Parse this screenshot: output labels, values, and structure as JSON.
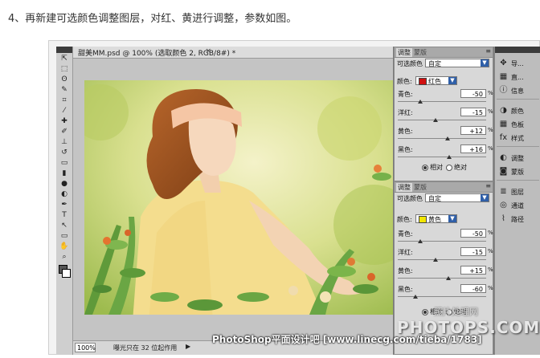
{
  "caption": "4、再新建可选颜色调整图层，对红、黄进行调整，参数如图。",
  "document": {
    "tab_title": "甜美MM.psd @ 100% (选取颜色 2, RGB/8#) *",
    "close_symbol": "×",
    "zoom": "100%",
    "status_info": "曝光只在 32 位起作用",
    "status_arrow": "▶"
  },
  "toolbar": {
    "tools": [
      "move-tool",
      "marquee-tool",
      "lasso-tool",
      "quick-select-tool",
      "crop-tool",
      "eyedropper-tool",
      "healing-tool",
      "brush-tool",
      "stamp-tool",
      "history-brush-tool",
      "eraser-tool",
      "gradient-tool",
      "blur-tool",
      "dodge-tool",
      "pen-tool",
      "type-tool",
      "path-select-tool",
      "shape-tool",
      "hand-tool",
      "zoom-tool"
    ],
    "glyphs": [
      "⇱",
      "⬚",
      "ʘ",
      "✎",
      "⌗",
      "⁄",
      "✚",
      "✐",
      "⊥",
      "↺",
      "▭",
      "▮",
      "●",
      "◐",
      "✒",
      "T",
      "↖",
      "▭",
      "✋",
      "⌕"
    ],
    "fg_color": "#555555",
    "bg_color": "#ffffff"
  },
  "panel_top": {
    "tab_adjust": "调整",
    "tab_mask": "蒙版",
    "menu_symbol": "≡",
    "title": "可选颜色",
    "preset": "自定",
    "colors_label": "颜色:",
    "color_value": "红色",
    "color_chip": "#d01010",
    "sliders": [
      {
        "label": "青色:",
        "value": "-50",
        "pct": "%",
        "level": -50
      },
      {
        "label": "洋红:",
        "value": "-15",
        "pct": "%",
        "level": -15
      },
      {
        "label": "黄色:",
        "value": "+12",
        "pct": "%",
        "level": 12
      },
      {
        "label": "黑色:",
        "value": "+16",
        "pct": "%",
        "level": 16
      }
    ],
    "radio_relative": "相对",
    "radio_absolute": "绝对"
  },
  "panel_bottom": {
    "tab_adjust": "调整",
    "tab_mask": "蒙版",
    "menu_symbol": "≡",
    "title": "可选颜色",
    "preset": "自定",
    "colors_label": "颜色:",
    "color_value": "黄色",
    "color_chip": "#f2e600",
    "sliders": [
      {
        "label": "青色:",
        "value": "-50",
        "pct": "%",
        "level": -50
      },
      {
        "label": "洋红:",
        "value": "-15",
        "pct": "%",
        "level": -15
      },
      {
        "label": "黄色:",
        "value": "+15",
        "pct": "%",
        "level": 15
      },
      {
        "label": "黑色:",
        "value": "-60",
        "pct": "%",
        "level": -60
      }
    ],
    "radio_relative": "相对",
    "radio_absolute": "绝对"
  },
  "dock": {
    "items": [
      {
        "icon": "navigator-icon",
        "glyph": "✥",
        "label": "导..."
      },
      {
        "icon": "histogram-icon",
        "glyph": "▦",
        "label": "直..."
      },
      {
        "icon": "info-icon",
        "glyph": "ⓘ",
        "label": "信息"
      },
      {
        "icon": "color-icon",
        "glyph": "◑",
        "label": "颜色"
      },
      {
        "icon": "swatches-icon",
        "glyph": "▦",
        "label": "色板"
      },
      {
        "icon": "styles-icon",
        "glyph": "fx",
        "label": "样式"
      },
      {
        "icon": "adjustments-icon",
        "glyph": "◐",
        "label": "调整"
      },
      {
        "icon": "masks-icon",
        "glyph": "◙",
        "label": "蒙版"
      },
      {
        "icon": "layers-icon",
        "glyph": "≣",
        "label": "图层"
      },
      {
        "icon": "channels-icon",
        "glyph": "◎",
        "label": "通道"
      },
      {
        "icon": "paths-icon",
        "glyph": "⌇",
        "label": "路径"
      }
    ],
    "separators_after": [
      2,
      5,
      7
    ]
  },
  "watermarks": {
    "site": "PhotoShop平面设计吧 [www.linecg.com/tieba/1783]",
    "top": "照片处理网",
    "big": "PHOTOPS.COM"
  },
  "colors": {
    "ps_dark": "#7a7a7a",
    "panel_bg": "#d8d8d8",
    "accent": "#2f5fa8"
  }
}
